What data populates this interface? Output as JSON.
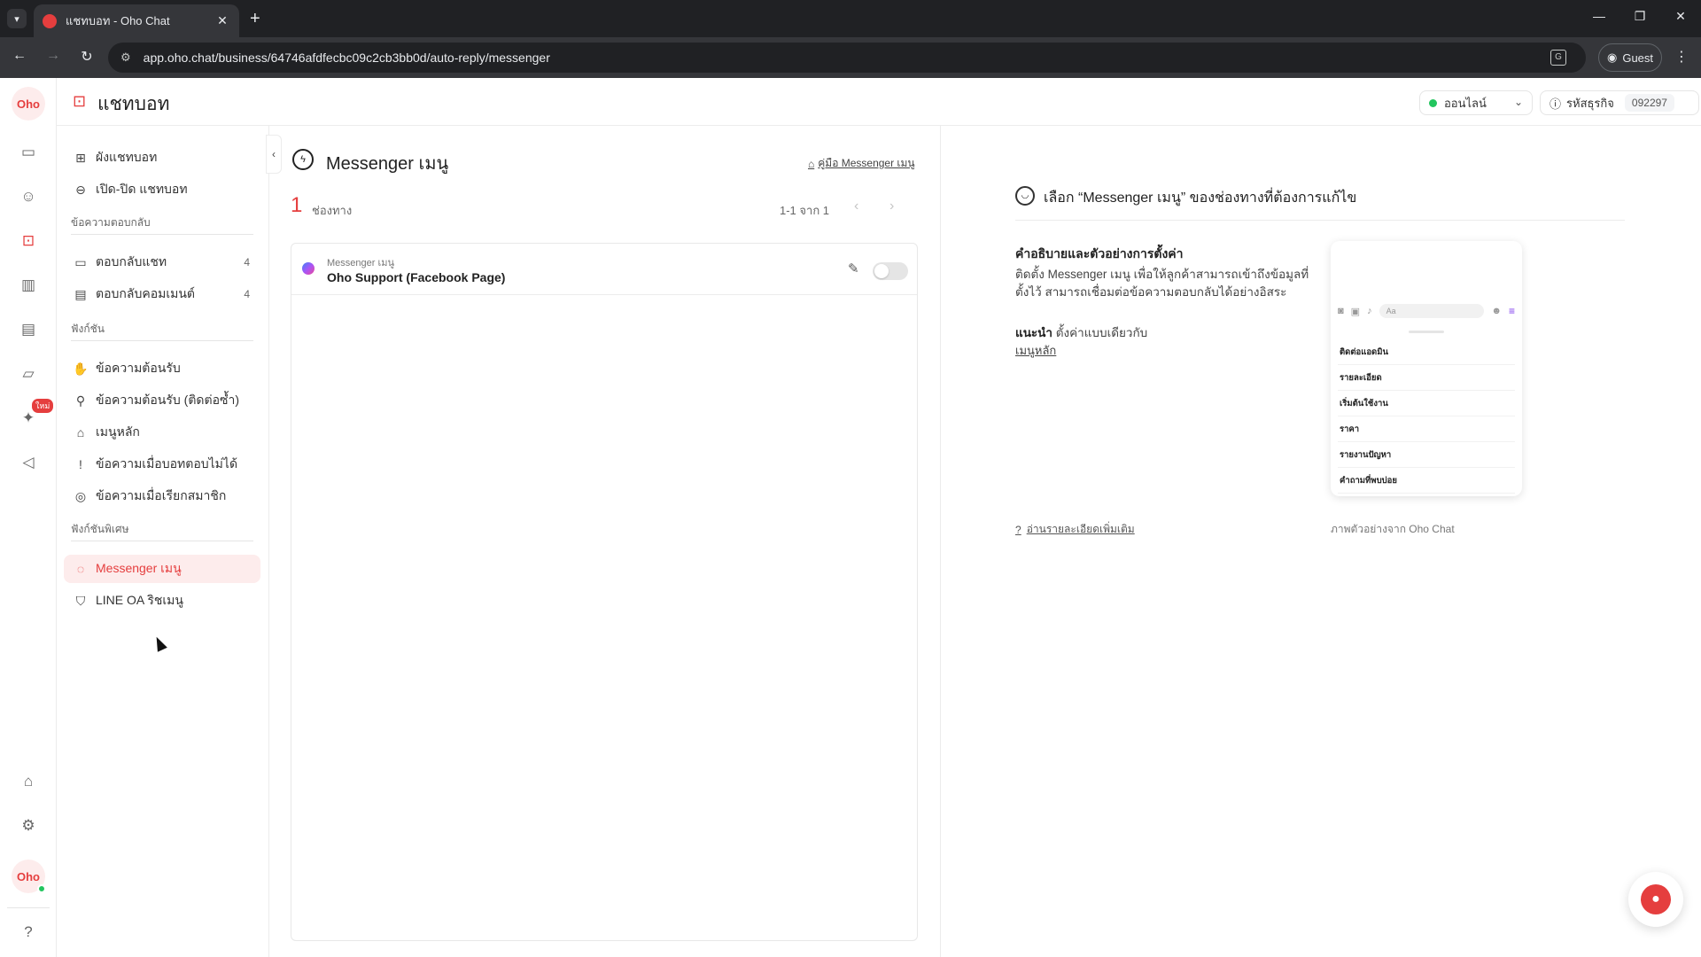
{
  "browser": {
    "tab_title": "แชทบอท - Oho Chat",
    "url": "app.oho.chat/business/64746afdfecbc09c2cb3bb0d/auto-reply/messenger",
    "guest_label": "Guest"
  },
  "rail": {
    "logo_text": "Oho",
    "avatar_text": "Oho",
    "new_badge": "ใหม่"
  },
  "topbar": {
    "title": "แชทบอท",
    "status": "ออนไลน์",
    "bizcode_label": "รหัสธุรกิจ",
    "bizcode_value": "092297"
  },
  "sidenav": {
    "items_top": [
      {
        "label": "ผังแชทบอท"
      },
      {
        "label": "เปิด-ปิด แชทบอท"
      }
    ],
    "section_reply": "ข้อความตอบกลับ",
    "items_reply": [
      {
        "label": "ตอบกลับแชท",
        "count": "4"
      },
      {
        "label": "ตอบกลับคอมเมนต์",
        "count": "4"
      }
    ],
    "section_functions": "ฟังก์ชัน",
    "items_functions": [
      {
        "label": "ข้อความต้อนรับ"
      },
      {
        "label": "ข้อความต้อนรับ (ติดต่อซ้ำ)"
      },
      {
        "label": "เมนูหลัก"
      },
      {
        "label": "ข้อความเมื่อบอทตอบไม่ได้"
      },
      {
        "label": "ข้อความเมื่อเรียกสมาชิก"
      }
    ],
    "section_special": "ฟังก์ชันพิเศษ",
    "items_special": [
      {
        "label": "Messenger เมนู"
      },
      {
        "label": "LINE OA ริชเมนู"
      }
    ]
  },
  "middle": {
    "title": "Messenger เมนู",
    "guide_link": "คู่มือ Messenger เมนู",
    "count": "1",
    "count_label": "ช่องทาง",
    "pagination": "1-1 จาก 1",
    "rows": [
      {
        "sub": "Messenger เมนู",
        "name": "Oho Support (Facebook Page)"
      }
    ]
  },
  "right": {
    "title": "เลือก “Messenger เมนู” ของช่องทางที่ต้องการแก้ไข",
    "desc_head": "คำอธิบายและตัวอย่างการตั้งค่า",
    "desc_body": "ติดตั้ง Messenger เมนู เพื่อให้ลูกค้าสามารถเข้าถึงข้อมูลที่ตั้งไว้ สามารถเชื่อมต่อข้อความตอบกลับได้อย่างอิสระ",
    "tip_bold": "แนะนำ",
    "tip_text": "ตั้งค่าแบบเดียวกับ",
    "tip_link": "เมนูหลัก",
    "preview_input": "Aa",
    "preview_items": [
      "ติดต่อแอดมิน",
      "รายละเอียด",
      "เริ่มต้นใช้งาน",
      "ราคา",
      "รายงานปัญหา",
      "คำถามที่พบบ่อย"
    ],
    "more_link": "อ่านรายละเอียดเพิ่มเติม",
    "preview_caption": "ภาพตัวอย่างจาก Oho Chat"
  }
}
